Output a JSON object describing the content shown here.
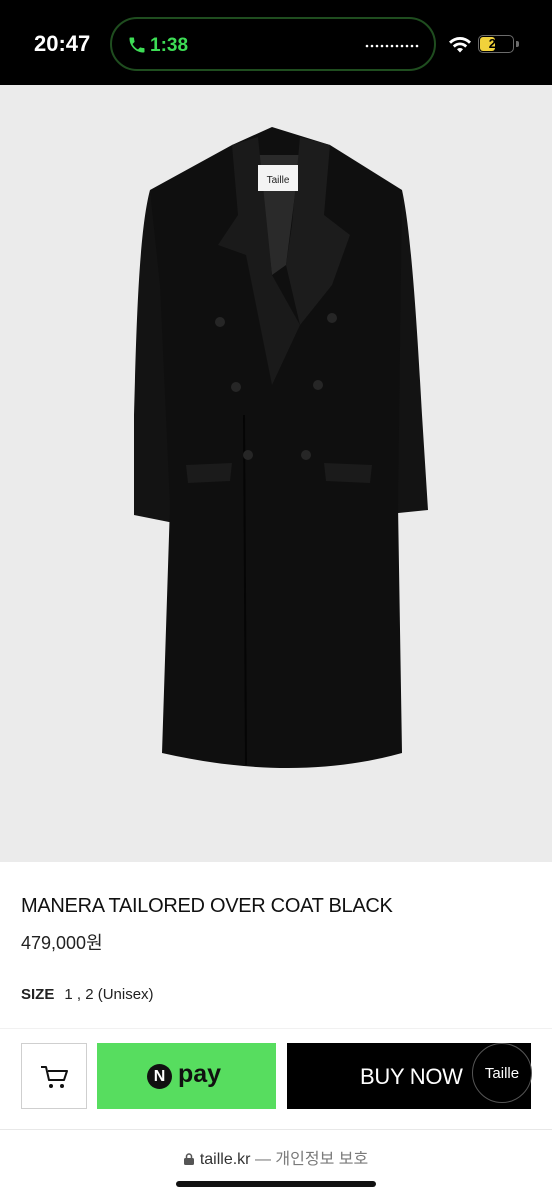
{
  "status_bar": {
    "time": "20:47",
    "call_duration": "1:38",
    "battery_level": "21",
    "icons": [
      "phone-icon",
      "wifi-icon",
      "battery-icon"
    ]
  },
  "product": {
    "image_brand_label": "Taille",
    "title": "MANERA TAILORED OVER COAT BLACK",
    "price": "479,000원",
    "size_label": "SIZE",
    "size_values": "1 , 2 (Unisex)"
  },
  "actions": {
    "cart_icon": "cart-icon",
    "npay_n": "N",
    "npay_label": "pay",
    "buy_label": "BUY NOW",
    "chat_label": "Taille"
  },
  "browser": {
    "url": "taille.kr",
    "separator": " — ",
    "privacy": "개인정보 보호"
  },
  "colors": {
    "npay_green": "#57dd5f",
    "call_green": "#3ddc55",
    "battery_yellow": "#f1d23b",
    "image_bg": "#ebebeb"
  }
}
